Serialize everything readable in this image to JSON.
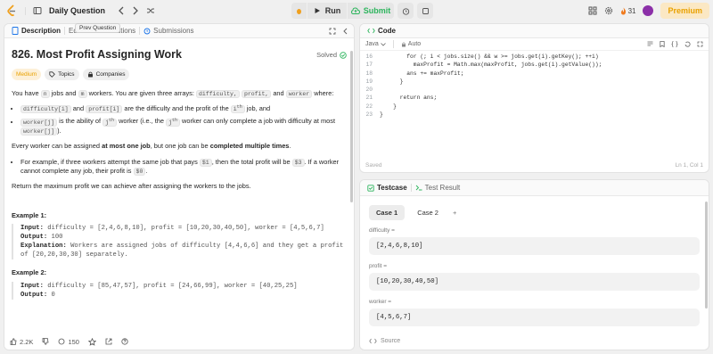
{
  "topbar": {
    "title": "Daily Question",
    "run_label": "Run",
    "submit_label": "Submit",
    "streak_count": "31",
    "premium_label": "Premium"
  },
  "tooltip": "Prev Question",
  "left_tabs": {
    "description": "Description",
    "editorial": "Ed",
    "solutions": "utions",
    "submissions": "Submissions"
  },
  "problem": {
    "title": "826. Most Profit Assigning Work",
    "solved": "Solved",
    "difficulty": "Medium",
    "topics": "Topics",
    "companies": "Companies",
    "intro_a": "You have",
    "n": "n",
    "intro_b": "jobs and",
    "m": "m",
    "intro_c": "workers. You are given three arrays:",
    "arr1": "difficulty,",
    "arr2": "profit,",
    "intro_d": "and",
    "arr3": "worker",
    "intro_e": "where:",
    "b1_code1": "difficulty[i]",
    "b1_and": "and",
    "b1_code2": "profit[i]",
    "b1_rest_a": "are the difficulty and the profit of the",
    "b1_code3": "i",
    "b1_sup": "th",
    "b1_rest_b": "job, and",
    "b2_code1": "worker[j]",
    "b2_text_a": "is the ability of",
    "b2_j": "j",
    "b2_sup": "th",
    "b2_text_b": "worker (i.e., the",
    "b2_text_c": "worker can only complete a job with difficulty at most",
    "b2_code2": "worker[j]",
    "b2_end": ").",
    "assign_a": "Every worker can be assigned",
    "assign_bold1": "at most one job",
    "assign_b": ", but one job can be",
    "assign_bold2": "completed multiple times",
    "assign_c": ".",
    "ex_a": "For example, if three workers attempt the same job that pays",
    "ex_code1": "$1",
    "ex_b": ", then the total profit will be",
    "ex_code2": "$3",
    "ex_c": ". If a worker cannot complete any job, their profit is",
    "ex_code3": "$0",
    "ex_d": ".",
    "return_text": "Return the maximum profit we can achieve after assigning the workers to the jobs.",
    "example1_title": "Example 1:",
    "example1_input_label": "Input:",
    "example1_input": "difficulty = [2,4,6,8,10], profit = [10,20,30,40,50], worker = [4,5,6,7]",
    "example1_output_label": "Output:",
    "example1_output": "100",
    "example1_expl_label": "Explanation:",
    "example1_expl": "Workers are assigned jobs of difficulty [4,4,6,6] and they get a profit of [20,20,30,30] separately.",
    "example2_title": "Example 2:",
    "example2_input_label": "Input:",
    "example2_input": "difficulty = [85,47,57], profit = [24,66,99], worker = [40,25,25]",
    "example2_output_label": "Output:",
    "example2_output": "0"
  },
  "bottom": {
    "likes": "2.2K",
    "comments": "150"
  },
  "code": {
    "tab_label": "Code",
    "language": "Java",
    "auto": "Auto",
    "lines": [
      {
        "n": "16",
        "t": "        for (; i < jobs.size() && w >= jobs.get(i).getKey(); ++i)"
      },
      {
        "n": "17",
        "t": "          maxProfit = Math.max(maxProfit, jobs.get(i).getValue());"
      },
      {
        "n": "18",
        "t": "        ans += maxProfit;"
      },
      {
        "n": "19",
        "t": "      }"
      },
      {
        "n": "20",
        "t": ""
      },
      {
        "n": "21",
        "t": "      return ans;"
      },
      {
        "n": "22",
        "t": "    }"
      },
      {
        "n": "23",
        "t": "}"
      }
    ],
    "saved": "Saved",
    "cursor": "Ln 1, Col 1"
  },
  "testcase": {
    "tab_label": "Testcase",
    "result_label": "Test Result",
    "case1": "Case 1",
    "case2": "Case 2",
    "add": "+",
    "f1_label": "difficulty =",
    "f1_value": "[2,4,6,8,10]",
    "f2_label": "profit =",
    "f2_value": "[10,20,30,40,50]",
    "f3_label": "worker =",
    "f3_value": "[4,5,6,7]",
    "source": "Source"
  },
  "colors": {
    "accent_green": "#2db55d",
    "premium": "#e9a100",
    "code_blue": "#1a73e8"
  }
}
